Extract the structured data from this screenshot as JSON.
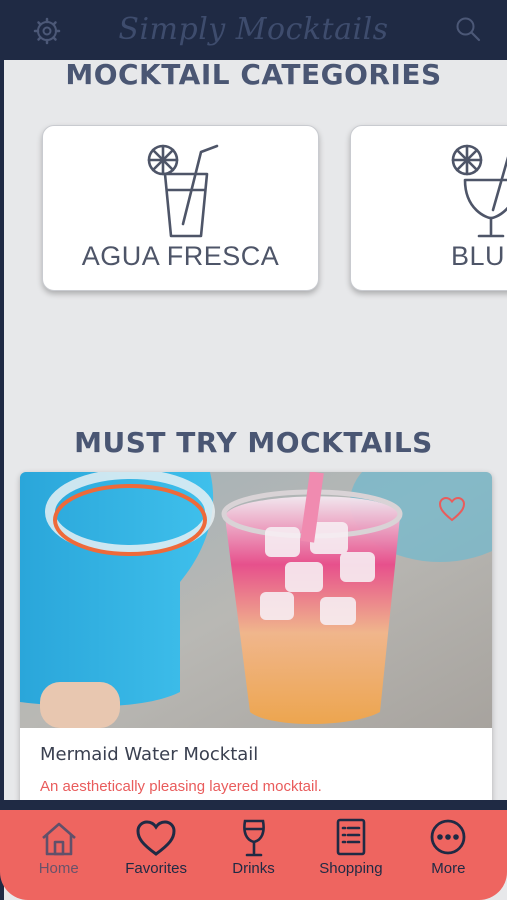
{
  "header": {
    "title": "Simply Mocktails",
    "settings_icon": "gear-icon",
    "search_icon": "search-icon"
  },
  "categories_section": {
    "title": "MOCKTAIL CATEGORIES",
    "items": [
      {
        "label": "AGUA FRESCA",
        "icon": "glass-with-lime-icon"
      },
      {
        "label": "BLU",
        "icon": "cocktail-glass-icon"
      }
    ]
  },
  "must_try_section": {
    "title": "MUST TRY MOCKTAILS",
    "featured": {
      "name": "Mermaid Water Mocktail",
      "description": "An aesthetically pleasing layered mocktail.",
      "favorite_icon": "heart-icon"
    }
  },
  "bottom_nav": {
    "items": [
      {
        "label": "Home",
        "icon": "home-icon",
        "active": true
      },
      {
        "label": "Favorites",
        "icon": "heart-icon"
      },
      {
        "label": "Drinks",
        "icon": "wine-glass-icon"
      },
      {
        "label": "Shopping",
        "icon": "list-icon"
      },
      {
        "label": "More",
        "icon": "more-icon"
      }
    ]
  },
  "colors": {
    "header_bg": "#1f2a44",
    "nav_bg": "#ee6560",
    "accent_text": "#e95c5c",
    "page_bg": "#e7e8ea"
  }
}
